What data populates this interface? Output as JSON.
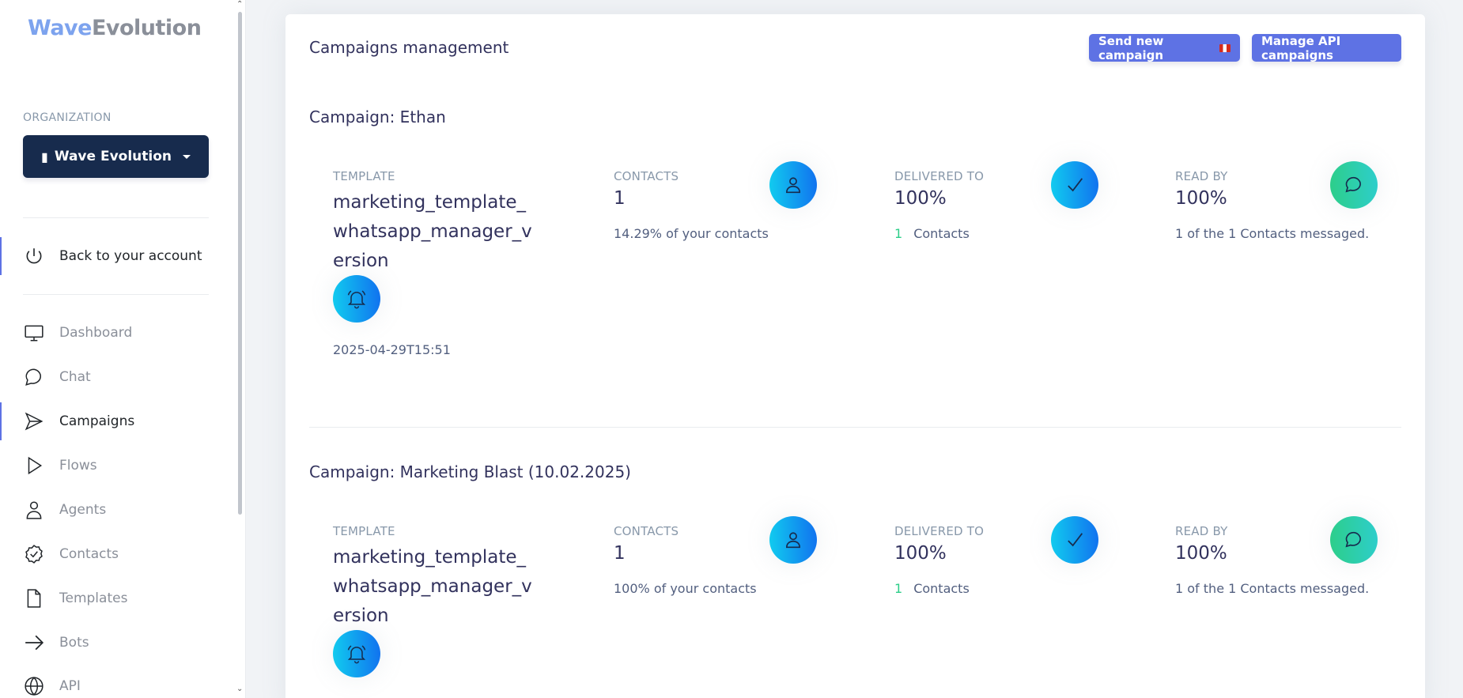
{
  "sidebar": {
    "logo_part1": "Wave",
    "logo_part2": "Evolution",
    "org_label": "ORGANIZATION",
    "org_button": "Wave Evolution",
    "back": "Back to your account",
    "items": [
      {
        "label": "Dashboard",
        "icon": "monitor-icon"
      },
      {
        "label": "Chat",
        "icon": "chat-icon"
      },
      {
        "label": "Campaigns",
        "icon": "send-icon",
        "active": true
      },
      {
        "label": "Flows",
        "icon": "play-icon"
      },
      {
        "label": "Agents",
        "icon": "user-icon"
      },
      {
        "label": "Contacts",
        "icon": "badge-check-icon"
      },
      {
        "label": "Templates",
        "icon": "file-icon"
      },
      {
        "label": "Bots",
        "icon": "arrow-right-icon"
      },
      {
        "label": "API",
        "icon": "globe-icon"
      }
    ]
  },
  "main": {
    "title": "Campaigns management",
    "send_button": "Send new campaign",
    "api_button": "Manage API campaigns",
    "campaigns": [
      {
        "title": "Campaign: Ethan",
        "template_label": "TEMPLATE",
        "template": "marketing_template_whatsapp_manager_version",
        "date": "2025-04-29T15:51",
        "contacts_label": "CONTACTS",
        "contacts": "1",
        "contacts_desc": "14.29% of your contacts",
        "delivered_label": "DELIVERED TO",
        "delivered": "100%",
        "delivered_count": "1",
        "delivered_desc": "Contacts",
        "read_label": "READ BY",
        "read": "100%",
        "read_desc": "1 of the 1 Contacts messaged."
      },
      {
        "title": "Campaign: Marketing Blast (10.02.2025)",
        "template_label": "TEMPLATE",
        "template": "marketing_template_whatsapp_manager_version",
        "contacts_label": "CONTACTS",
        "contacts": "1",
        "contacts_desc": "100% of your contacts",
        "delivered_label": "DELIVERED TO",
        "delivered": "100%",
        "delivered_count": "1",
        "delivered_desc": "Contacts",
        "read_label": "READ BY",
        "read": "100%",
        "read_desc": "1 of the 1 Contacts messaged."
      }
    ]
  },
  "colors": {
    "primary": "#5e72e4",
    "sidebar_org_bg": "#172b4d",
    "icon_blue_from": "#11cdef",
    "icon_blue_to": "#1171ef",
    "icon_green": "#2dce89"
  }
}
